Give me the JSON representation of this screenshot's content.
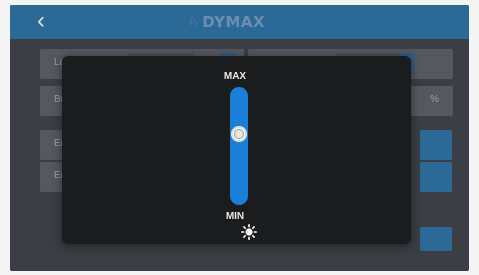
{
  "header": {
    "back_icon": "chevron-left-icon",
    "brand_name": "DYMAX",
    "brand_color": "#2b6a97"
  },
  "settings": {
    "row1_left_label": "Lan",
    "row2_left_label": "Brig",
    "row2_right_unit": "%",
    "row3_left_label": "Er",
    "row4_left_label": "Er"
  },
  "brightness_modal": {
    "max_label": "MAX",
    "min_label": "MIN",
    "level_percent": 60,
    "track_color": "#1a7fd6",
    "icon": "sun-brightness-icon"
  }
}
